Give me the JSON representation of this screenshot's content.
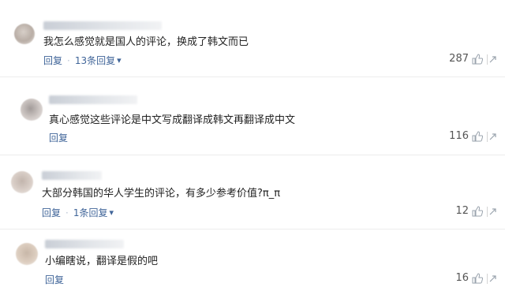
{
  "comments": [
    {
      "text": "我怎么感觉就是国人的评论，换成了韩文而已",
      "reply_label": "回复",
      "replies_label": "13条回复",
      "likes": "287"
    },
    {
      "text": "真心感觉这些评论是中文写成翻译成韩文再翻译成中文",
      "reply_label": "回复",
      "likes": "116"
    },
    {
      "text": "大部分韩国的华人学生的评论，有多少参考价值?π_π",
      "reply_label": "回复",
      "replies_label": "1条回复",
      "likes": "12"
    },
    {
      "text": "小编瞎说，翻译是假的吧",
      "reply_label": "回复",
      "likes": "16"
    }
  ],
  "colors": {
    "link": "#406599",
    "text": "#222222",
    "divider": "#ececec"
  }
}
